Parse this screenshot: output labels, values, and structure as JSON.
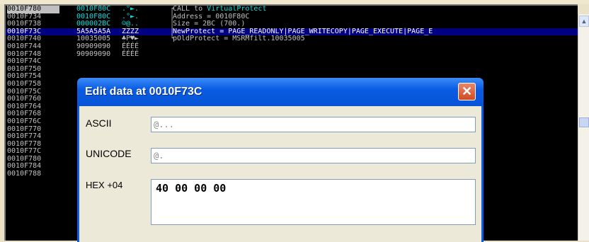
{
  "stack": {
    "rows": [
      {
        "addr": "0010F780",
        "val": "0010F80C",
        "asc": ".°►.",
        "cmt": "CALL to ",
        "cmt_hl": "VirtualProtect",
        "bracket": "┌",
        "style": "first cyan"
      },
      {
        "addr": "0010F734",
        "val": "0010F80C",
        "asc": ".°►.",
        "cmt": "Address = 0010F80C",
        "cmt_hl": "",
        "bracket": "│",
        "style": "cyan"
      },
      {
        "addr": "0010F738",
        "val": "000002BC",
        "asc": "☺@..",
        "cmt": "Size = 2BC (700.)",
        "cmt_hl": "",
        "bracket": "│",
        "style": "cyan"
      },
      {
        "addr": "0010F73C",
        "val": "5A5A5A5A",
        "asc": "ZZZZ",
        "cmt": "NewProtect = PAGE_READONLY|PAGE_WRITECOPY|PAGE_EXECUTE|PAGE_E",
        "cmt_hl": "",
        "bracket": "│",
        "style": "selected"
      },
      {
        "addr": "0010F740",
        "val": "10035005",
        "asc": "♣P♥►",
        "cmt": "pOldProtect = MSRMfilt.10035005",
        "cmt_hl": "",
        "bracket": "└",
        "style": ""
      },
      {
        "addr": "0010F744",
        "val": "90909090",
        "asc": "ÉÉÉÉ",
        "cmt": "",
        "cmt_hl": "",
        "bracket": "",
        "style": ""
      },
      {
        "addr": "0010F748",
        "val": "90909090",
        "asc": "ÉÉÉÉ",
        "cmt": "",
        "cmt_hl": "",
        "bracket": "",
        "style": ""
      },
      {
        "addr": "0010F74C",
        "val": "",
        "asc": "",
        "cmt": "",
        "cmt_hl": "",
        "bracket": "",
        "style": ""
      },
      {
        "addr": "0010F750",
        "val": "",
        "asc": "",
        "cmt": "",
        "cmt_hl": "",
        "bracket": "",
        "style": ""
      },
      {
        "addr": "0010F754",
        "val": "",
        "asc": "",
        "cmt": "",
        "cmt_hl": "",
        "bracket": "",
        "style": ""
      },
      {
        "addr": "0010F758",
        "val": "",
        "asc": "",
        "cmt": "",
        "cmt_hl": "",
        "bracket": "",
        "style": ""
      },
      {
        "addr": "0010F75C",
        "val": "",
        "asc": "",
        "cmt": "",
        "cmt_hl": "",
        "bracket": "",
        "style": ""
      },
      {
        "addr": "0010F760",
        "val": "",
        "asc": "",
        "cmt": "",
        "cmt_hl": "",
        "bracket": "",
        "style": ""
      },
      {
        "addr": "0010F764",
        "val": "",
        "asc": "",
        "cmt": "",
        "cmt_hl": "",
        "bracket": "",
        "style": ""
      },
      {
        "addr": "0010F768",
        "val": "",
        "asc": "",
        "cmt": "",
        "cmt_hl": "",
        "bracket": "",
        "style": ""
      },
      {
        "addr": "0010F76C",
        "val": "",
        "asc": "",
        "cmt": "",
        "cmt_hl": "",
        "bracket": "",
        "style": ""
      },
      {
        "addr": "0010F770",
        "val": "",
        "asc": "",
        "cmt": "",
        "cmt_hl": "",
        "bracket": "",
        "style": ""
      },
      {
        "addr": "0010F774",
        "val": "",
        "asc": "",
        "cmt": "",
        "cmt_hl": "",
        "bracket": "",
        "style": ""
      },
      {
        "addr": "0010F778",
        "val": "",
        "asc": "",
        "cmt": "",
        "cmt_hl": "",
        "bracket": "",
        "style": ""
      },
      {
        "addr": "0010F77C",
        "val": "",
        "asc": "",
        "cmt": "",
        "cmt_hl": "",
        "bracket": "",
        "style": ""
      },
      {
        "addr": "0010F780",
        "val": "",
        "asc": "",
        "cmt": "",
        "cmt_hl": "",
        "bracket": "",
        "style": ""
      },
      {
        "addr": "0010F784",
        "val": "",
        "asc": "",
        "cmt": "",
        "cmt_hl": "",
        "bracket": "",
        "style": ""
      },
      {
        "addr": "0010F788",
        "val": "",
        "asc": "",
        "cmt": "",
        "cmt_hl": "",
        "bracket": "",
        "style": ""
      }
    ]
  },
  "dialog": {
    "title": "Edit data at 0010F73C",
    "close_glyph": "✕",
    "ascii_label": "ASCII",
    "ascii_value": "@...",
    "unicode_label": "UNICODE",
    "unicode_value": "@.",
    "hex_label": "HEX +04",
    "hex_value": "40 00 00 00"
  },
  "scrollbar": {
    "up_glyph": "▲"
  },
  "colors": {
    "titlebar": "#0a5ce3",
    "close": "#d04a21",
    "stack_bg": "#000000",
    "stack_text": "#c0c0c0",
    "stack_cyan": "#00e0e0",
    "selection": "#000080"
  }
}
